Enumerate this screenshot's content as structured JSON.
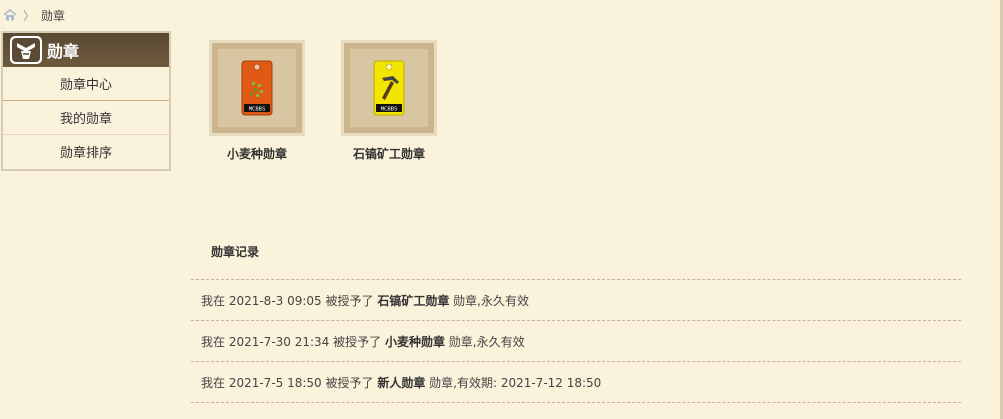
{
  "breadcrumb": {
    "home_icon": "home-icon",
    "separator": "〉",
    "current": "勋章"
  },
  "sidebar": {
    "title": "勋章",
    "items": [
      {
        "label": "勋章中心"
      },
      {
        "label": "我的勋章"
      },
      {
        "label": "勋章排序"
      }
    ]
  },
  "medals": [
    {
      "name": "小麦种勋章",
      "icon": "wheat-seed-medal-icon",
      "tag_color": "#e05a16",
      "mark": "MCBBS"
    },
    {
      "name": "石镐矿工勋章",
      "icon": "stone-pickaxe-medal-icon",
      "tag_color": "#f2e600",
      "mark": "MCBBS"
    }
  ],
  "records": {
    "title": "勋章记录",
    "rows": [
      {
        "prefix": "我在 2021-8-3 09:05 被授予了 ",
        "medal": "石镐矿工勋章",
        "suffix": " 勋章,永久有效"
      },
      {
        "prefix": "我在 2021-7-30 21:34 被授予了 ",
        "medal": "小麦种勋章",
        "suffix": " 勋章,永久有效"
      },
      {
        "prefix": "我在 2021-7-5 18:50 被授予了 ",
        "medal": "新人勋章",
        "suffix": " 勋章,有效期: 2021-7-12 18:50"
      }
    ]
  },
  "colors": {
    "background": "#fbf2db",
    "sidebar_header": "#5a4933",
    "border": "#d7cdb4"
  }
}
